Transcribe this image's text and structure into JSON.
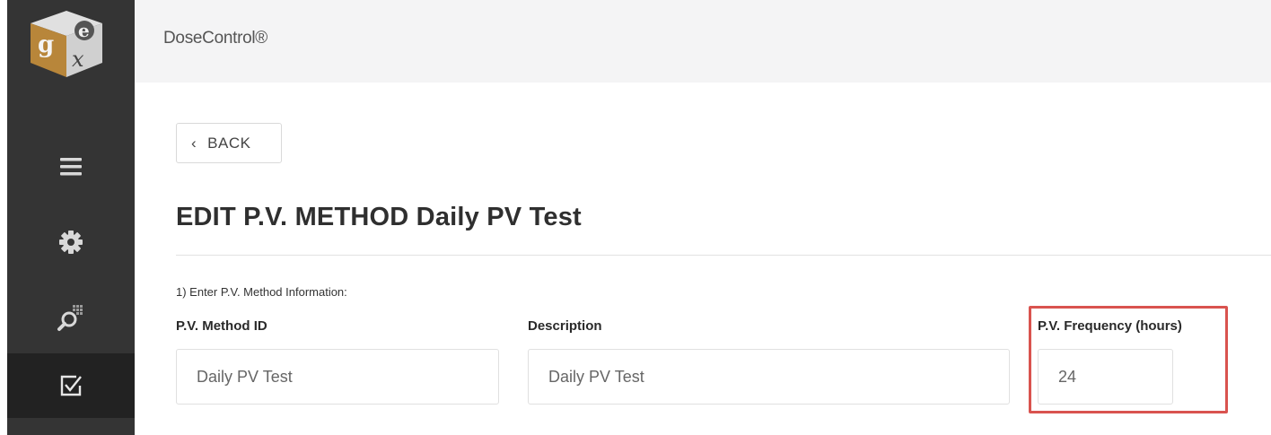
{
  "app": {
    "title": "DoseControl®"
  },
  "logo": {
    "letters": [
      "g",
      "e",
      "x"
    ]
  },
  "sidebar": {
    "items": [
      {
        "icon": "hamburger-menu-icon"
      },
      {
        "icon": "gear-icon"
      },
      {
        "icon": "search-grid-icon"
      },
      {
        "icon": "checkbox-icon",
        "active": true
      }
    ]
  },
  "back_button": {
    "label": "BACK"
  },
  "page": {
    "title": "EDIT P.V. METHOD Daily PV Test",
    "section_label": "1) Enter P.V. Method Information:"
  },
  "form": {
    "method_id": {
      "label": "P.V. Method ID",
      "value": "Daily PV Test"
    },
    "description": {
      "label": "Description",
      "value": "Daily PV Test"
    },
    "frequency": {
      "label": "P.V. Frequency (hours)",
      "value": "24"
    }
  },
  "colors": {
    "sidebar_bg": "#343434",
    "sidebar_active_bg": "#222222",
    "topbar_bg": "#f4f4f5",
    "highlight": "#d9534f"
  }
}
